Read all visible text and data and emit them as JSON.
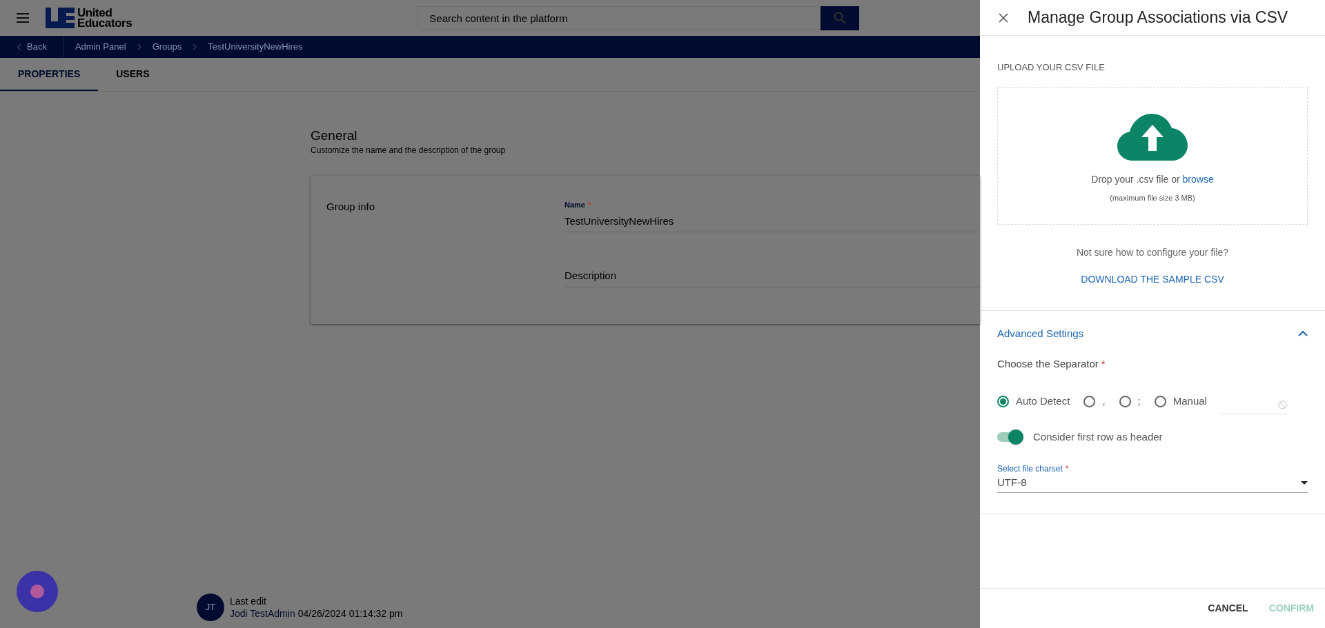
{
  "header": {
    "logo_lines": [
      "United",
      "Educators"
    ],
    "search": {
      "placeholder": "Search content in the platform"
    }
  },
  "breadcrumb": {
    "back": "Back",
    "items": [
      "Admin Panel",
      "Groups",
      "TestUniversityNewHires"
    ]
  },
  "tabs": [
    {
      "label": "PROPERTIES",
      "selected": true
    },
    {
      "label": "USERS",
      "selected": false
    }
  ],
  "general": {
    "title": "General",
    "subtitle": "Customize the name and the description of the group",
    "card_title": "Group info",
    "fields": [
      {
        "label": "Name",
        "required_mark": "*",
        "value": "TestUniversityNewHires"
      },
      {
        "placeholder": "Description"
      }
    ]
  },
  "footer": {
    "initials": "JT",
    "label": "Last edit",
    "user": "Jodi TestAdmin",
    "timestamp": "04/26/2024 01:14:32 pm"
  },
  "panel": {
    "title": "Manage Group Associations via CSV",
    "upload_label": "UPLOAD YOUR CSV FILE",
    "drop_text": "Drop your .csv file or",
    "browse": "browse",
    "size_note": "(maximum file size 3 MB)",
    "help": "Not sure how to configure your file?",
    "download": "DOWNLOAD THE SAMPLE CSV",
    "advanced": {
      "title": "Advanced Settings",
      "expanded": true,
      "separator_label": "Choose the Separator",
      "separator_required_mark": "*",
      "options": [
        {
          "label": "Auto Detect",
          "selected": true
        },
        {
          "label": ",",
          "selected": false
        },
        {
          "label": ";",
          "selected": false
        },
        {
          "label": "Manual",
          "selected": false
        }
      ],
      "header_toggle": {
        "label": "Consider first row as header",
        "on": true
      },
      "charset": {
        "label": "Select file charset",
        "required_mark": "*",
        "value": "UTF-8"
      }
    },
    "buttons": [
      {
        "label": "CANCEL",
        "disabled": false
      },
      {
        "label": "CONFIRM",
        "disabled": true
      }
    ]
  }
}
